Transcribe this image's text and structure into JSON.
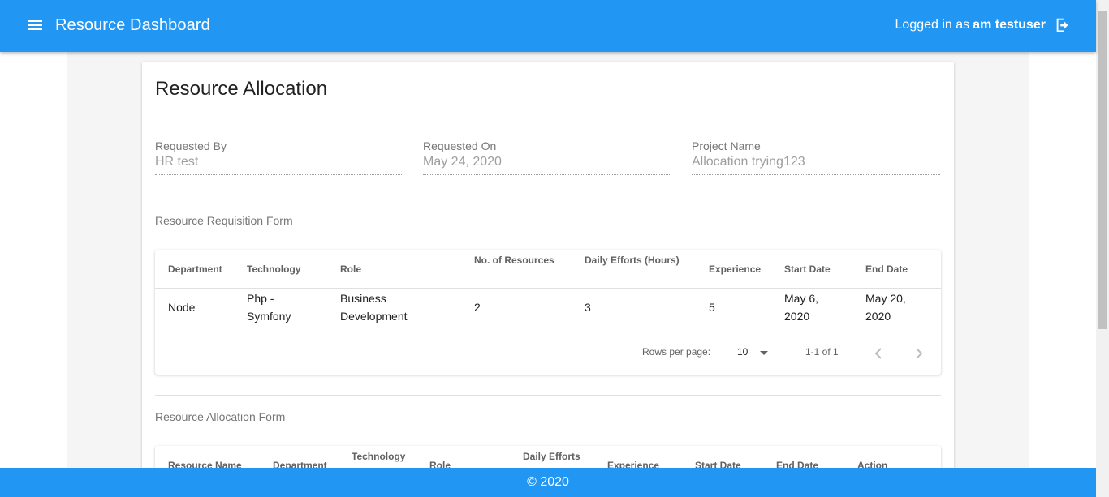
{
  "header": {
    "title": "Resource Dashboard",
    "logged_in_prefix": "Logged in as",
    "username": "am testuser"
  },
  "card": {
    "title": "Resource Allocation",
    "fields": [
      {
        "label": "Requested By",
        "value": "HR test"
      },
      {
        "label": "Requested On",
        "value": "May 24, 2020"
      },
      {
        "label": "Project Name",
        "value": "Allocation trying123"
      }
    ]
  },
  "requisition": {
    "section_label": "Resource Requisition Form",
    "columns": [
      "Department",
      "Technology",
      "Role",
      "No. of Resources",
      "Daily Efforts (Hours)",
      "Experience",
      "Start Date",
      "End Date"
    ],
    "rows": [
      {
        "department": "Node",
        "technology": [
          "Php -",
          "Symfony"
        ],
        "role": [
          "Business",
          "Development"
        ],
        "resources": "2",
        "efforts": "3",
        "experience": "5",
        "start_date": [
          "May 6,",
          "2020"
        ],
        "end_date": [
          "May 20,",
          "2020"
        ]
      }
    ],
    "pagination": {
      "rows_per_page_label": "Rows per page:",
      "rows_per_page_value": "10",
      "range": "1-1 of 1"
    }
  },
  "allocation": {
    "section_label": "Resource Allocation Form",
    "columns": [
      "Resource Name",
      "Department",
      "Technology",
      "Role",
      "Daily Efforts",
      "Experience",
      "Start Date",
      "End Date",
      "Action"
    ]
  },
  "footer": {
    "copyright": "© 2020"
  },
  "colors": {
    "primary": "#2196f3",
    "page_bg": "#f5f5f5"
  },
  "icons": [
    "menu-icon",
    "logout-icon",
    "chevron-left-icon",
    "chevron-right-icon",
    "dropdown-caret-icon"
  ]
}
